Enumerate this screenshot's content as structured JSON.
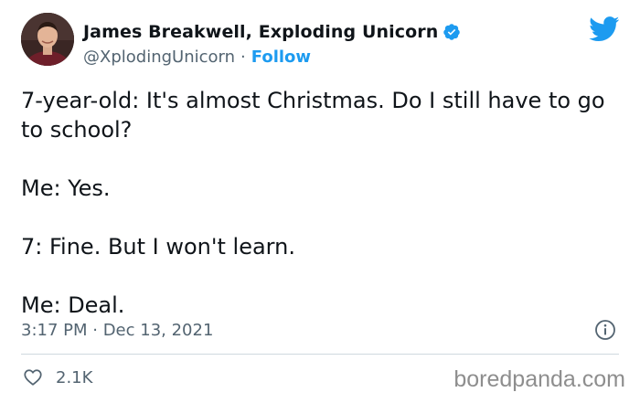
{
  "author": {
    "display_name": "James Breakwell, Exploding Unicorn",
    "handle": "@XplodingUnicorn",
    "separator": "·",
    "follow_label": "Follow",
    "verified": true
  },
  "icons": {
    "avatar": "profile-photo",
    "verified": "verified-badge-icon",
    "brand": "twitter-bird-icon",
    "info": "info-icon",
    "like": "heart-icon"
  },
  "tweet": {
    "paragraphs": [
      "7-year-old: It's almost Christmas. Do I still have to go to school?",
      "Me: Yes.",
      "7: Fine. But I won't learn.",
      "Me: Deal."
    ],
    "timestamp": "3:17 PM · Dec 13, 2021"
  },
  "engagement": {
    "likes": "2.1K"
  },
  "watermark": "boredpanda.com",
  "colors": {
    "accent": "#1d9bf0",
    "text_primary": "#0f1419",
    "text_secondary": "#536471",
    "divider": "#cfd9de",
    "watermark": "#8e8e8e"
  }
}
